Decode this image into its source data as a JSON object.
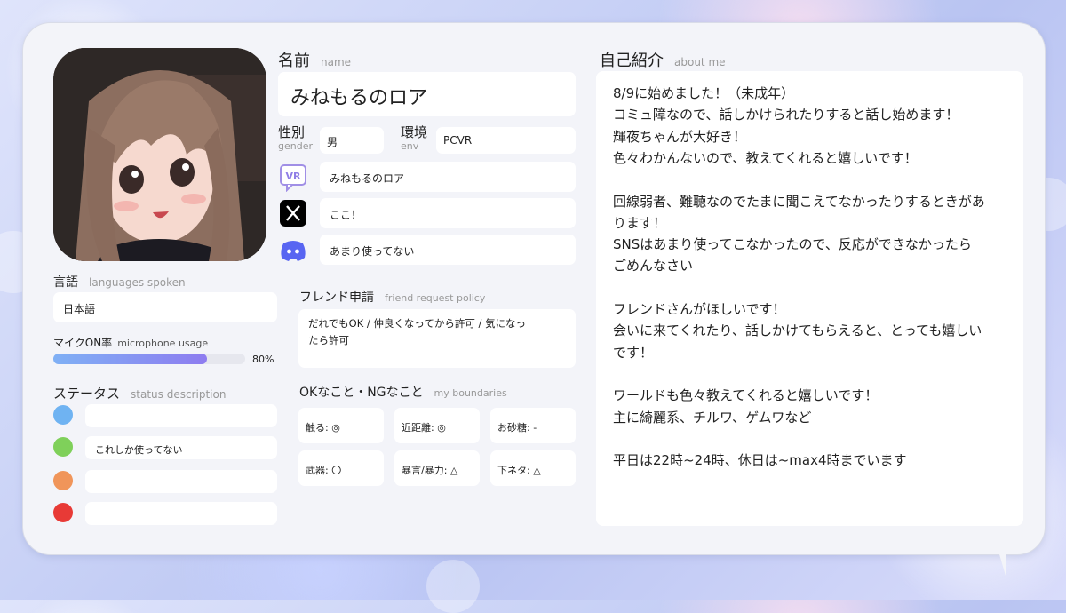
{
  "name": {
    "label": "名前",
    "sub": "name",
    "value": "みねもるのロア"
  },
  "gender": {
    "label": "性別",
    "sub": "gender",
    "value": "男"
  },
  "env": {
    "label": "環境",
    "sub": "env",
    "value": "PCVR"
  },
  "socials": [
    {
      "icon": "vrchat-icon",
      "value": "みねもるのロア"
    },
    {
      "icon": "x-icon",
      "value": "ここ！"
    },
    {
      "icon": "discord-icon",
      "value": "あまり使ってない"
    }
  ],
  "languages": {
    "label": "言語",
    "sub": "languages spoken",
    "value": "日本語"
  },
  "mic": {
    "label": "マイクON率",
    "sub": "microphone usage",
    "percent_text": "80%",
    "fraction": 0.8
  },
  "status": {
    "label": "ステータス",
    "sub": "status description",
    "items": [
      {
        "color": "#6fb3f2",
        "text": ""
      },
      {
        "color": "#7fd05a",
        "text": "これしか使ってない"
      },
      {
        "color": "#f0955a",
        "text": ""
      },
      {
        "color": "#e83a36",
        "text": ""
      }
    ]
  },
  "friend": {
    "label": "フレンド申請",
    "sub": "friend request policy",
    "value_line1": "だれでもOK / 仲良くなってから許可 / 気になっ",
    "value_line2": "たら許可"
  },
  "boundaries": {
    "label": "OKなこと・NGなこと",
    "sub": "my boundaries",
    "items": [
      "触る: ◎",
      "近距離: ◎",
      "お砂糖: -",
      "武器: 〇",
      "暴言/暴力: △",
      "下ネタ: △"
    ]
  },
  "about": {
    "label": "自己紹介",
    "sub": "about me",
    "lines": [
      "8/9に始めました！（未成年）",
      "コミュ障なので、話しかけられたりすると話し始めます！",
      "輝夜ちゃんが大好き！",
      "色々わかんないので、教えてくれると嬉しいです！",
      "",
      "回線弱者、難聴なのでたまに聞こえてなかったりするときがあ",
      "ります！",
      "SNSはあまり使ってこなかったので、反応ができなかったら",
      "ごめんなさい",
      "",
      "フレンドさんがほしいです！",
      "会いに来てくれたり、話しかけてもらえると、とっても嬉しい",
      "です！",
      "",
      "ワールドも色々教えてくれると嬉しいです！",
      "主に綺麗系、チルワ、ゲムワなど",
      "",
      "平日は22時~24時、休日は~max4時までいます"
    ]
  }
}
